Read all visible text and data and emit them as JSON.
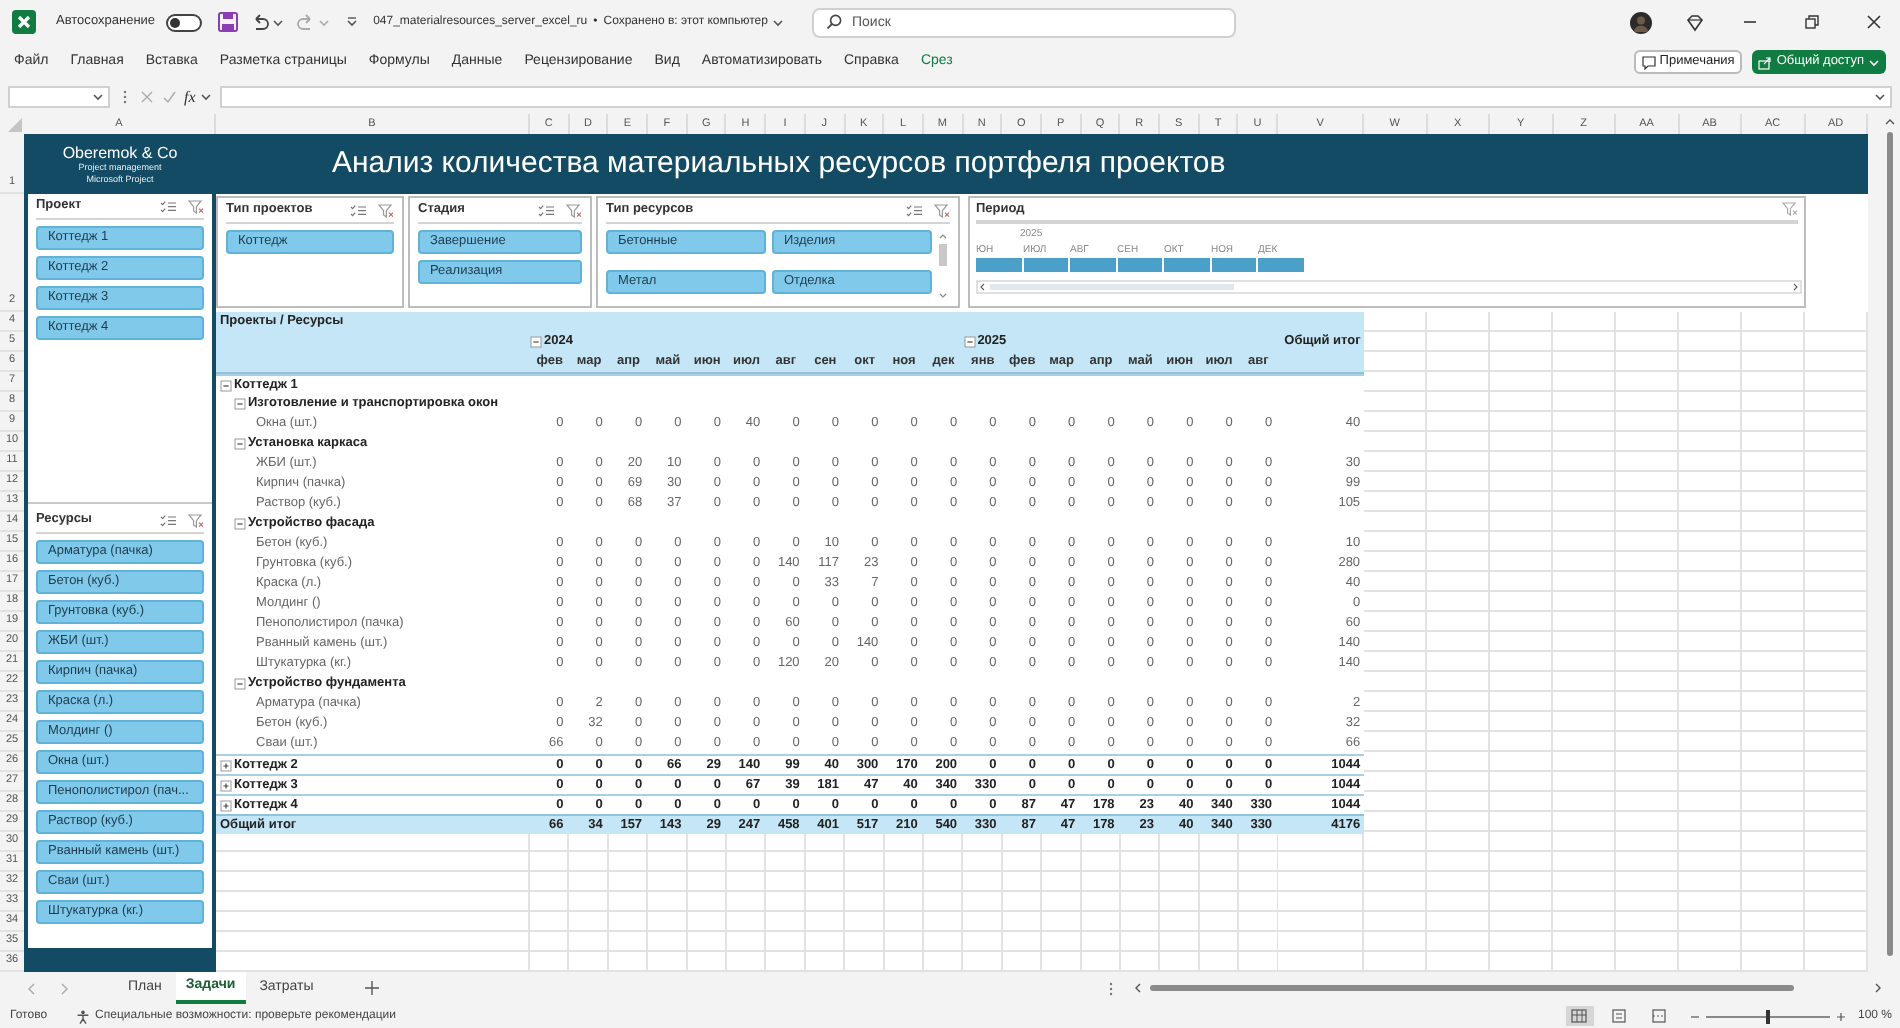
{
  "title_bar": {
    "autosave_label": "Автосохранение",
    "autosave_on": false,
    "file_name": "047_materialresources_server_excel_ru",
    "separator": "•",
    "save_status": "Сохранено в: этот компьютер",
    "search_placeholder": "Поиск"
  },
  "ribbon": {
    "tabs": [
      {
        "label": "Файл",
        "kind": "standard"
      },
      {
        "label": "Главная",
        "kind": "standard"
      },
      {
        "label": "Вставка",
        "kind": "standard"
      },
      {
        "label": "Разметка страницы",
        "kind": "standard"
      },
      {
        "label": "Формулы",
        "kind": "standard"
      },
      {
        "label": "Данные",
        "kind": "standard"
      },
      {
        "label": "Рецензирование",
        "kind": "standard"
      },
      {
        "label": "Вид",
        "kind": "standard"
      },
      {
        "label": "Автоматизировать",
        "kind": "standard"
      },
      {
        "label": "Справка",
        "kind": "standard"
      },
      {
        "label": "Срез",
        "kind": "contextual"
      }
    ],
    "comments_button": "Примечания",
    "share_button": "Общий доступ"
  },
  "formula_bar": {
    "function_label": "fx"
  },
  "column_headers": [
    "A",
    "B",
    "C",
    "D",
    "E",
    "F",
    "G",
    "H",
    "I",
    "J",
    "K",
    "L",
    "M",
    "N",
    "O",
    "P",
    "Q",
    "R",
    "S",
    "T",
    "U",
    "V",
    "W",
    "X",
    "Y",
    "Z",
    "AA",
    "AB",
    "AC",
    "AD"
  ],
  "row_numbers": [
    "1",
    "2",
    "4",
    "5",
    "6",
    "7",
    "8",
    "9",
    "10",
    "11",
    "12",
    "13",
    "14",
    "15",
    "16",
    "17",
    "18",
    "19",
    "20",
    "21",
    "22",
    "23",
    "24",
    "25",
    "26",
    "27",
    "28",
    "29",
    "30",
    "31",
    "32",
    "33",
    "34",
    "35",
    "36"
  ],
  "report_header": {
    "company": "Oberemok & Co",
    "tagline": [
      "Project management",
      "Microsoft Project"
    ],
    "title": "Анализ количества материальных ресурсов портфеля проектов"
  },
  "left_slicers": [
    {
      "title": "Проект",
      "items": [
        {
          "label": "Коттедж 1",
          "selected": true
        },
        {
          "label": "Коттедж 2",
          "selected": true
        },
        {
          "label": "Коттедж 3",
          "selected": true
        },
        {
          "label": "Коттедж 4",
          "selected": true
        }
      ]
    },
    {
      "title": "Ресурсы",
      "items": [
        {
          "label": "Арматура (пачка)",
          "selected": true
        },
        {
          "label": "Бетон (куб.)",
          "selected": true
        },
        {
          "label": "Грунтовка (куб.)",
          "selected": true
        },
        {
          "label": "ЖБИ (шт.)",
          "selected": true
        },
        {
          "label": "Кирпич (пачка)",
          "selected": true
        },
        {
          "label": "Краска (л.)",
          "selected": true
        },
        {
          "label": "Молдинг ()",
          "selected": true
        },
        {
          "label": "Окна (шт.)",
          "selected": true
        },
        {
          "label": "Пенополистирол (пач...",
          "selected": true
        },
        {
          "label": "Раствор (куб.)",
          "selected": true
        },
        {
          "label": "Рванный камень (шт.)",
          "selected": true
        },
        {
          "label": "Сваи (шт.)",
          "selected": true
        },
        {
          "label": "Штукатурка (кг.)",
          "selected": true
        }
      ]
    }
  ],
  "top_slicers": [
    {
      "title": "Тип проектов",
      "items": [
        {
          "label": "Коттедж",
          "selected": true
        }
      ]
    },
    {
      "title": "Стадия",
      "items": [
        {
          "label": "Завершение",
          "selected": true
        },
        {
          "label": "Реализация",
          "selected": true
        }
      ]
    },
    {
      "title": "Тип ресурсов",
      "items": [
        {
          "label": "Бетонные",
          "selected": true
        },
        {
          "label": "Изделия",
          "selected": true
        },
        {
          "label": "Метал",
          "selected": true
        },
        {
          "label": "Отделка",
          "selected": true
        }
      ]
    }
  ],
  "period_timeline": {
    "title": "Период",
    "year": "2025",
    "months": [
      {
        "label": "ЮН",
        "selected": true
      },
      {
        "label": "ИЮЛ",
        "selected": true
      },
      {
        "label": "АВГ",
        "selected": true
      },
      {
        "label": "СЕН",
        "selected": true
      },
      {
        "label": "ОКТ",
        "selected": true
      },
      {
        "label": "НОЯ",
        "selected": true
      },
      {
        "label": "ДЕК",
        "selected": true
      }
    ]
  },
  "pivot": {
    "corner_label": "Проекты / Ресурсы",
    "total_header": "Общий итог",
    "years": [
      {
        "label": "2024",
        "expanded": true,
        "months": [
          "фев",
          "мар",
          "апр",
          "май",
          "июн",
          "июл",
          "авг",
          "сен",
          "окт",
          "ноя",
          "дек"
        ]
      },
      {
        "label": "2025",
        "expanded": true,
        "months": [
          "янв",
          "фев",
          "мар",
          "апр",
          "май",
          "июн",
          "июл",
          "авг"
        ]
      }
    ],
    "projects": [
      {
        "label": "Коттедж 1",
        "expanded": true,
        "children": [
          {
            "label": "Изготовление и транспортировка окон",
            "expanded": true,
            "children": [
              {
                "label": "Окна (шт.)",
                "values": [
                  "0",
                  "0",
                  "0",
                  "0",
                  "0",
                  "40",
                  "0",
                  "0",
                  "0",
                  "0",
                  "0",
                  "0",
                  "0",
                  "0",
                  "0",
                  "0",
                  "0",
                  "0",
                  "0"
                ],
                "total": "40"
              }
            ]
          },
          {
            "label": "Установка каркаса",
            "expanded": true,
            "children": [
              {
                "label": "ЖБИ (шт.)",
                "values": [
                  "0",
                  "0",
                  "20",
                  "10",
                  "0",
                  "0",
                  "0",
                  "0",
                  "0",
                  "0",
                  "0",
                  "0",
                  "0",
                  "0",
                  "0",
                  "0",
                  "0",
                  "0",
                  "0"
                ],
                "total": "30"
              },
              {
                "label": "Кирпич (пачка)",
                "values": [
                  "0",
                  "0",
                  "69",
                  "30",
                  "0",
                  "0",
                  "0",
                  "0",
                  "0",
                  "0",
                  "0",
                  "0",
                  "0",
                  "0",
                  "0",
                  "0",
                  "0",
                  "0",
                  "0"
                ],
                "total": "99"
              },
              {
                "label": "Раствор (куб.)",
                "values": [
                  "0",
                  "0",
                  "68",
                  "37",
                  "0",
                  "0",
                  "0",
                  "0",
                  "0",
                  "0",
                  "0",
                  "0",
                  "0",
                  "0",
                  "0",
                  "0",
                  "0",
                  "0",
                  "0"
                ],
                "total": "105"
              }
            ]
          },
          {
            "label": "Устройство фасада",
            "expanded": true,
            "children": [
              {
                "label": "Бетон (куб.)",
                "values": [
                  "0",
                  "0",
                  "0",
                  "0",
                  "0",
                  "0",
                  "0",
                  "10",
                  "0",
                  "0",
                  "0",
                  "0",
                  "0",
                  "0",
                  "0",
                  "0",
                  "0",
                  "0",
                  "0"
                ],
                "total": "10"
              },
              {
                "label": "Грунтовка (куб.)",
                "values": [
                  "0",
                  "0",
                  "0",
                  "0",
                  "0",
                  "0",
                  "140",
                  "117",
                  "23",
                  "0",
                  "0",
                  "0",
                  "0",
                  "0",
                  "0",
                  "0",
                  "0",
                  "0",
                  "0"
                ],
                "total": "280"
              },
              {
                "label": "Краска (л.)",
                "values": [
                  "0",
                  "0",
                  "0",
                  "0",
                  "0",
                  "0",
                  "0",
                  "33",
                  "7",
                  "0",
                  "0",
                  "0",
                  "0",
                  "0",
                  "0",
                  "0",
                  "0",
                  "0",
                  "0"
                ],
                "total": "40"
              },
              {
                "label": "Молдинг ()",
                "values": [
                  "0",
                  "0",
                  "0",
                  "0",
                  "0",
                  "0",
                  "0",
                  "0",
                  "0",
                  "0",
                  "0",
                  "0",
                  "0",
                  "0",
                  "0",
                  "0",
                  "0",
                  "0",
                  "0"
                ],
                "total": "0"
              },
              {
                "label": "Пенополистирол (пачка)",
                "values": [
                  "0",
                  "0",
                  "0",
                  "0",
                  "0",
                  "0",
                  "60",
                  "0",
                  "0",
                  "0",
                  "0",
                  "0",
                  "0",
                  "0",
                  "0",
                  "0",
                  "0",
                  "0",
                  "0"
                ],
                "total": "60"
              },
              {
                "label": "Рванный камень (шт.)",
                "values": [
                  "0",
                  "0",
                  "0",
                  "0",
                  "0",
                  "0",
                  "0",
                  "0",
                  "140",
                  "0",
                  "0",
                  "0",
                  "0",
                  "0",
                  "0",
                  "0",
                  "0",
                  "0",
                  "0"
                ],
                "total": "140"
              },
              {
                "label": "Штукатурка (кг.)",
                "values": [
                  "0",
                  "0",
                  "0",
                  "0",
                  "0",
                  "0",
                  "120",
                  "20",
                  "0",
                  "0",
                  "0",
                  "0",
                  "0",
                  "0",
                  "0",
                  "0",
                  "0",
                  "0",
                  "0"
                ],
                "total": "140"
              }
            ]
          },
          {
            "label": "Устройство фундамента",
            "expanded": true,
            "children": [
              {
                "label": "Арматура (пачка)",
                "values": [
                  "0",
                  "2",
                  "0",
                  "0",
                  "0",
                  "0",
                  "0",
                  "0",
                  "0",
                  "0",
                  "0",
                  "0",
                  "0",
                  "0",
                  "0",
                  "0",
                  "0",
                  "0",
                  "0"
                ],
                "total": "2"
              },
              {
                "label": "Бетон (куб.)",
                "values": [
                  "0",
                  "32",
                  "0",
                  "0",
                  "0",
                  "0",
                  "0",
                  "0",
                  "0",
                  "0",
                  "0",
                  "0",
                  "0",
                  "0",
                  "0",
                  "0",
                  "0",
                  "0",
                  "0"
                ],
                "total": "32"
              },
              {
                "label": "Сваи (шт.)",
                "values": [
                  "66",
                  "0",
                  "0",
                  "0",
                  "0",
                  "0",
                  "0",
                  "0",
                  "0",
                  "0",
                  "0",
                  "0",
                  "0",
                  "0",
                  "0",
                  "0",
                  "0",
                  "0",
                  "0"
                ],
                "total": "66"
              }
            ]
          }
        ]
      },
      {
        "label": "Коттедж 2",
        "expanded": false,
        "values": [
          "0",
          "0",
          "0",
          "66",
          "29",
          "140",
          "99",
          "40",
          "300",
          "170",
          "200",
          "0",
          "0",
          "0",
          "0",
          "0",
          "0",
          "0",
          "0"
        ],
        "total": "1044"
      },
      {
        "label": "Коттедж 3",
        "expanded": false,
        "values": [
          "0",
          "0",
          "0",
          "0",
          "0",
          "67",
          "39",
          "181",
          "47",
          "40",
          "340",
          "330",
          "0",
          "0",
          "0",
          "0",
          "0",
          "0",
          "0"
        ],
        "total": "1044"
      },
      {
        "label": "Коттедж 4",
        "expanded": false,
        "values": [
          "0",
          "0",
          "0",
          "0",
          "0",
          "0",
          "0",
          "0",
          "0",
          "0",
          "0",
          "0",
          "87",
          "47",
          "178",
          "23",
          "40",
          "340",
          "330"
        ],
        "total": "1044"
      }
    ],
    "grand_total": {
      "label": "Общий итог",
      "values": [
        "66",
        "34",
        "157",
        "143",
        "29",
        "247",
        "458",
        "401",
        "517",
        "210",
        "540",
        "330",
        "87",
        "47",
        "178",
        "23",
        "40",
        "340",
        "330"
      ],
      "total": "4176"
    }
  },
  "sheet_tabs": [
    {
      "label": "План",
      "selected": false
    },
    {
      "label": "Задачи",
      "selected": true
    },
    {
      "label": "Затраты",
      "selected": false
    }
  ],
  "status_bar": {
    "ready": "Готово",
    "accessibility": "Специальные возможности: проверьте рекомендации",
    "views": [
      {
        "kind": "normal",
        "selected": true
      },
      {
        "kind": "page_layout",
        "selected": false
      },
      {
        "kind": "page_break",
        "selected": false
      }
    ],
    "zoom_slider": {
      "level": 0.5
    },
    "zoom": "100 %"
  }
}
